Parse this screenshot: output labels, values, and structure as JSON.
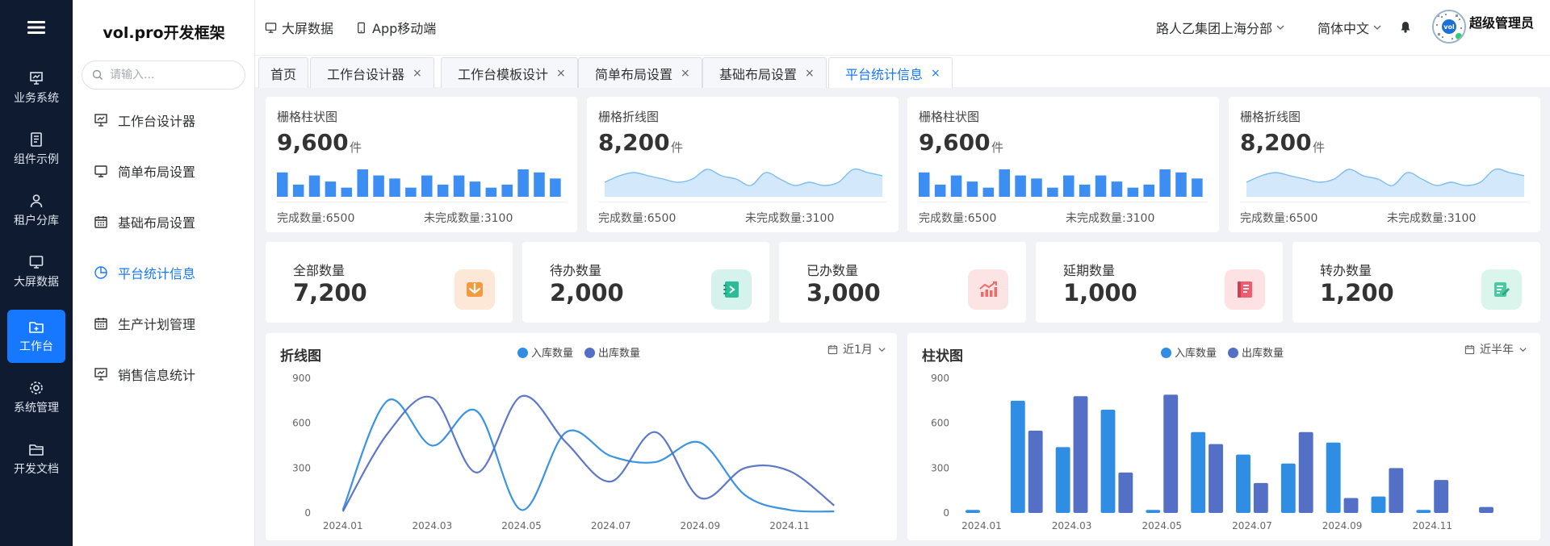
{
  "rail": {
    "items": [
      {
        "label": "业务系统"
      },
      {
        "label": "组件示例"
      },
      {
        "label": "租户分库"
      },
      {
        "label": "大屏数据"
      },
      {
        "label": "工作台"
      },
      {
        "label": "系统管理"
      },
      {
        "label": "开发文档"
      }
    ]
  },
  "menu": {
    "brand": "vol.pro开发框架",
    "search_placeholder": "请输入...",
    "items": [
      {
        "label": "工作台设计器"
      },
      {
        "label": "简单布局设置"
      },
      {
        "label": "基础布局设置"
      },
      {
        "label": "平台统计信息"
      },
      {
        "label": "生产计划管理"
      },
      {
        "label": "销售信息统计"
      }
    ]
  },
  "header": {
    "big_screen": "大屏数据",
    "mobile": "App移动端",
    "org": "路人乙集团上海分部",
    "language": "简体中文",
    "username": "超级管理员",
    "avatar_text": "vol"
  },
  "tabs": [
    {
      "label": "首页"
    },
    {
      "label": "工作台设计器"
    },
    {
      "label": "工作台模板设计"
    },
    {
      "label": "简单布局设置"
    },
    {
      "label": "基础布局设置"
    },
    {
      "label": "平台统计信息"
    }
  ],
  "tab_close": "×",
  "stat_cards": [
    {
      "title": "栅格柱状图",
      "value": "9,600",
      "unit": "件",
      "done": "完成数量:6500",
      "undone": "未完成数量:3100"
    },
    {
      "title": "栅格折线图",
      "value": "8,200",
      "unit": "件",
      "done": "完成数量:6500",
      "undone": "未完成数量:3100"
    },
    {
      "title": "栅格柱状图",
      "value": "9,600",
      "unit": "件",
      "done": "完成数量:6500",
      "undone": "未完成数量:3100"
    },
    {
      "title": "栅格折线图",
      "value": "8,200",
      "unit": "件",
      "done": "完成数量:6500",
      "undone": "未完成数量:3100"
    }
  ],
  "mini_bars": [
    8,
    4,
    7,
    5,
    3,
    9,
    7,
    6,
    3,
    7,
    4,
    7,
    5,
    3,
    4,
    9,
    8,
    6
  ],
  "mini_line": [
    3,
    5,
    6,
    5,
    4,
    3,
    4,
    7,
    5,
    4,
    2,
    6,
    4,
    2,
    3,
    2,
    3,
    7,
    6,
    5
  ],
  "kpis": [
    {
      "title": "全部数量",
      "value": "7,200",
      "icon": "inbox-icon",
      "bg": "#fde7d6",
      "fg": "#f39a3f"
    },
    {
      "title": "待办数量",
      "value": "2,000",
      "icon": "notebook-icon",
      "bg": "#d5f3ec",
      "fg": "#2bbd97"
    },
    {
      "title": "已办数量",
      "value": "3,000",
      "icon": "chart-growth-icon",
      "bg": "#fde4e4",
      "fg": "#ee6b6b"
    },
    {
      "title": "延期数量",
      "value": "1,000",
      "icon": "book-icon",
      "bg": "#fde1e3",
      "fg": "#ef5c6e"
    },
    {
      "title": "转办数量",
      "value": "1,200",
      "icon": "edit-doc-icon",
      "bg": "#d9f5ec",
      "fg": "#4cc9a0"
    }
  ],
  "chart_data": [
    {
      "type": "line",
      "title": "折线图",
      "range_label": "近1月",
      "ylim": [
        0,
        900
      ],
      "yticks": [
        "0",
        "300",
        "600",
        "900"
      ],
      "xlabels": [
        "2024.01",
        "2024.03",
        "2024.05",
        "2024.07",
        "2024.09",
        "2024.11"
      ],
      "x": [
        "2024.01",
        "2024.02",
        "2024.03",
        "2024.04",
        "2024.05",
        "2024.06",
        "2024.07",
        "2024.08",
        "2024.09",
        "2024.10",
        "2024.11",
        "2024.12"
      ],
      "series": [
        {
          "name": "入库数量",
          "color": "#2f8de4",
          "values": [
            20,
            750,
            450,
            680,
            20,
            540,
            380,
            340,
            470,
            120,
            20,
            10
          ]
        },
        {
          "name": "出库数量",
          "color": "#5470c6",
          "values": [
            10,
            530,
            770,
            270,
            780,
            470,
            210,
            540,
            100,
            300,
            280,
            50
          ]
        }
      ]
    },
    {
      "type": "bar",
      "title": "柱状图",
      "range_label": "近半年",
      "ylim": [
        0,
        900
      ],
      "yticks": [
        "0",
        "300",
        "600",
        "900"
      ],
      "xlabels": [
        "2024.01",
        "2024.03",
        "2024.05",
        "2024.07",
        "2024.09",
        "2024.11"
      ],
      "categories": [
        "2024.01",
        "2024.02",
        "2024.03",
        "2024.04",
        "2024.05",
        "2024.06",
        "2024.07",
        "2024.08",
        "2024.09",
        "2024.10",
        "2024.11",
        "2024.12"
      ],
      "series": [
        {
          "name": "入库数量",
          "color": "#2f8de4",
          "values": [
            20,
            750,
            440,
            690,
            20,
            540,
            390,
            330,
            470,
            110,
            20,
            0
          ]
        },
        {
          "name": "出库数量",
          "color": "#5470c6",
          "values": [
            0,
            550,
            780,
            270,
            790,
            460,
            200,
            540,
            100,
            300,
            220,
            40
          ]
        }
      ]
    }
  ]
}
